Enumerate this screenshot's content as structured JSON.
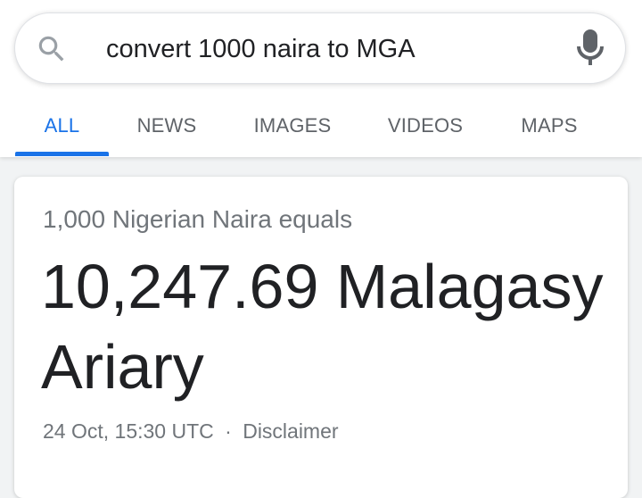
{
  "search": {
    "query": "convert 1000 naira to MGA"
  },
  "tabs": [
    {
      "label": "ALL",
      "active": true
    },
    {
      "label": "NEWS",
      "active": false
    },
    {
      "label": "IMAGES",
      "active": false
    },
    {
      "label": "VIDEOS",
      "active": false
    },
    {
      "label": "MAPS",
      "active": false
    }
  ],
  "converter": {
    "from_line": "1,000 Nigerian Naira equals",
    "result": "10,247.69 Malagasy Ariary",
    "timestamp": "24 Oct, 15:30 UTC",
    "separator": "·",
    "disclaimer": "Disclaimer"
  },
  "icons": {
    "search": "search-icon",
    "mic": "microphone-icon"
  },
  "colors": {
    "accent": "#1a73e8",
    "text_primary": "#202124",
    "text_secondary": "#70757a",
    "tab_inactive": "#5f6368",
    "mic_grey": "#5f6368",
    "search_grey": "#9aa0a6"
  }
}
